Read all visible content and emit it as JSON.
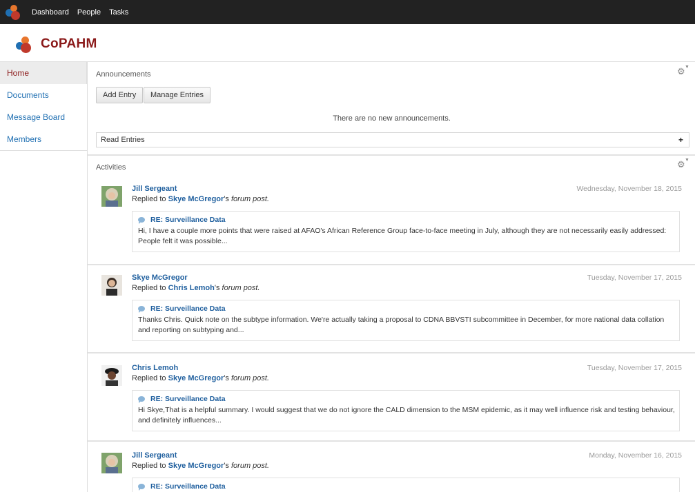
{
  "topbar": {
    "nav": [
      "Dashboard",
      "People",
      "Tasks"
    ]
  },
  "brand": {
    "title": "CoPAHM"
  },
  "sidebar": {
    "items": [
      {
        "label": "Home",
        "active": true
      },
      {
        "label": "Documents"
      },
      {
        "label": "Message Board"
      },
      {
        "label": "Members"
      }
    ]
  },
  "announcements": {
    "title": "Announcements",
    "add_entry": "Add Entry",
    "manage_entries": "Manage Entries",
    "empty_message": "There are no new announcements.",
    "read_entries": "Read Entries",
    "expand_symbol": "+"
  },
  "activities": {
    "title": "Activities",
    "verb": "Replied to",
    "object": "forum post.",
    "items": [
      {
        "author": "Jill Sergeant",
        "date": "Wednesday, November 18, 2015",
        "target": "Skye McGregor",
        "post_title": "RE: Surveillance Data",
        "excerpt": "Hi, I have a couple more points that were raised at AFAO's African Reference Group face-to-face meeting in July, although they are not necessarily easily addressed: People felt it was possible..."
      },
      {
        "author": "Skye McGregor",
        "date": "Tuesday, November 17, 2015",
        "target": "Chris Lemoh",
        "post_title": "RE: Surveillance Data",
        "excerpt": "Thanks Chris. Quick note on the subtype information. We're actually taking a proposal to CDNA BBVSTI subcommittee in December, for more national data collation and reporting on subtyping and..."
      },
      {
        "author": "Chris Lemoh",
        "date": "Tuesday, November 17, 2015",
        "target": "Skye McGregor",
        "post_title": "RE: Surveillance Data",
        "excerpt": "Hi Skye,That is a helpful summary. I would suggest that we do not ignore the CALD dimension to the MSM epidemic, as it may well influence risk and testing behaviour, and definitely influences..."
      },
      {
        "author": "Jill Sergeant",
        "date": "Monday, November 16, 2015",
        "target": "Skye McGregor",
        "post_title": "RE: Surveillance Data",
        "excerpt": ""
      }
    ]
  },
  "colors": {
    "brand": "#8b1a1a",
    "link": "#1f5f9e",
    "topbar": "#222222"
  }
}
